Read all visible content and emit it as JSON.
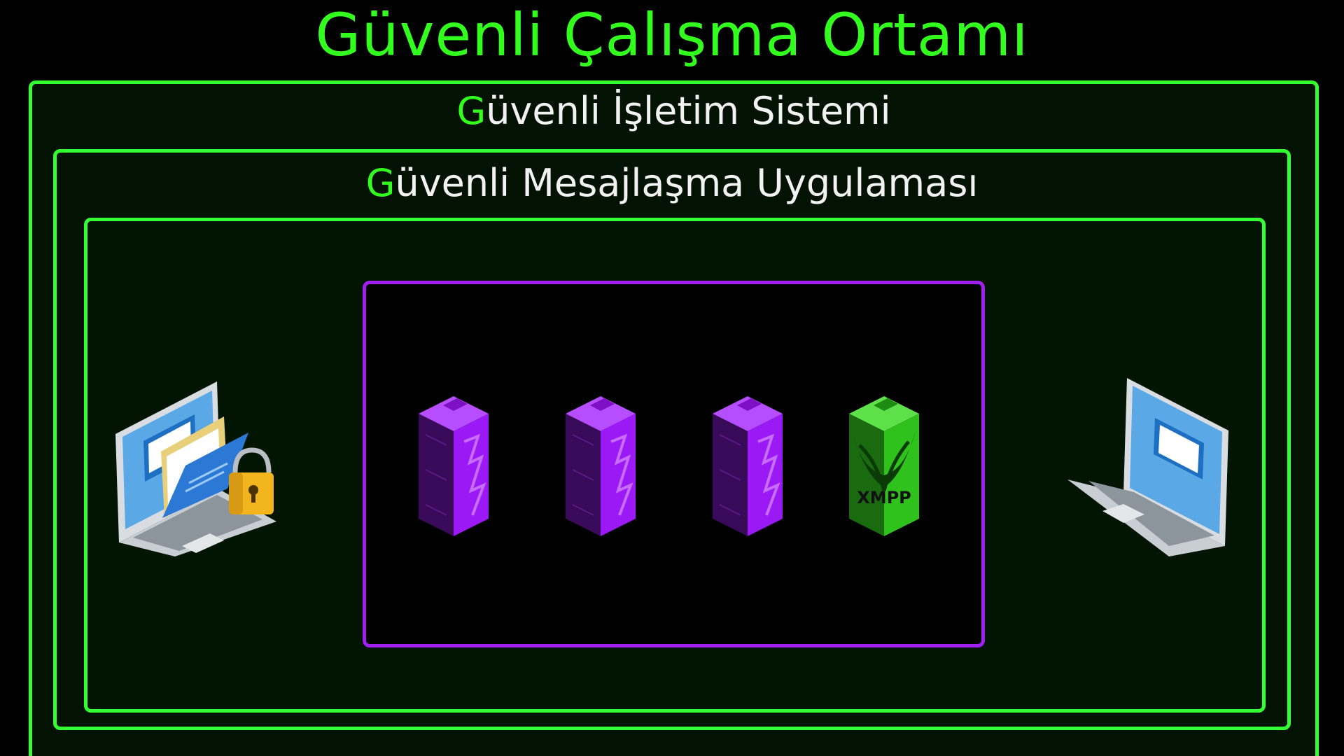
{
  "title": "Güvenli Çalışma Ortamı",
  "layers": {
    "os": {
      "accent": "G",
      "rest": "üvenli İşletim Sistemi"
    },
    "app": {
      "accent": "G",
      "rest": "üvenli Mesajlaşma Uygulaması"
    }
  },
  "servers": [
    {
      "color": "purple"
    },
    {
      "color": "purple"
    },
    {
      "color": "purple"
    },
    {
      "color": "green",
      "label": "XMPP"
    }
  ],
  "colors": {
    "accent_green": "#33ff1f",
    "border_green": "#33ff33",
    "server_zone": "#a020f0",
    "server_purple": "#9b19f5",
    "server_green": "#2fc21c"
  },
  "icons": [
    "laptop-secure-folder-icon",
    "server-icon",
    "xmpp-server-icon",
    "laptop-icon"
  ]
}
